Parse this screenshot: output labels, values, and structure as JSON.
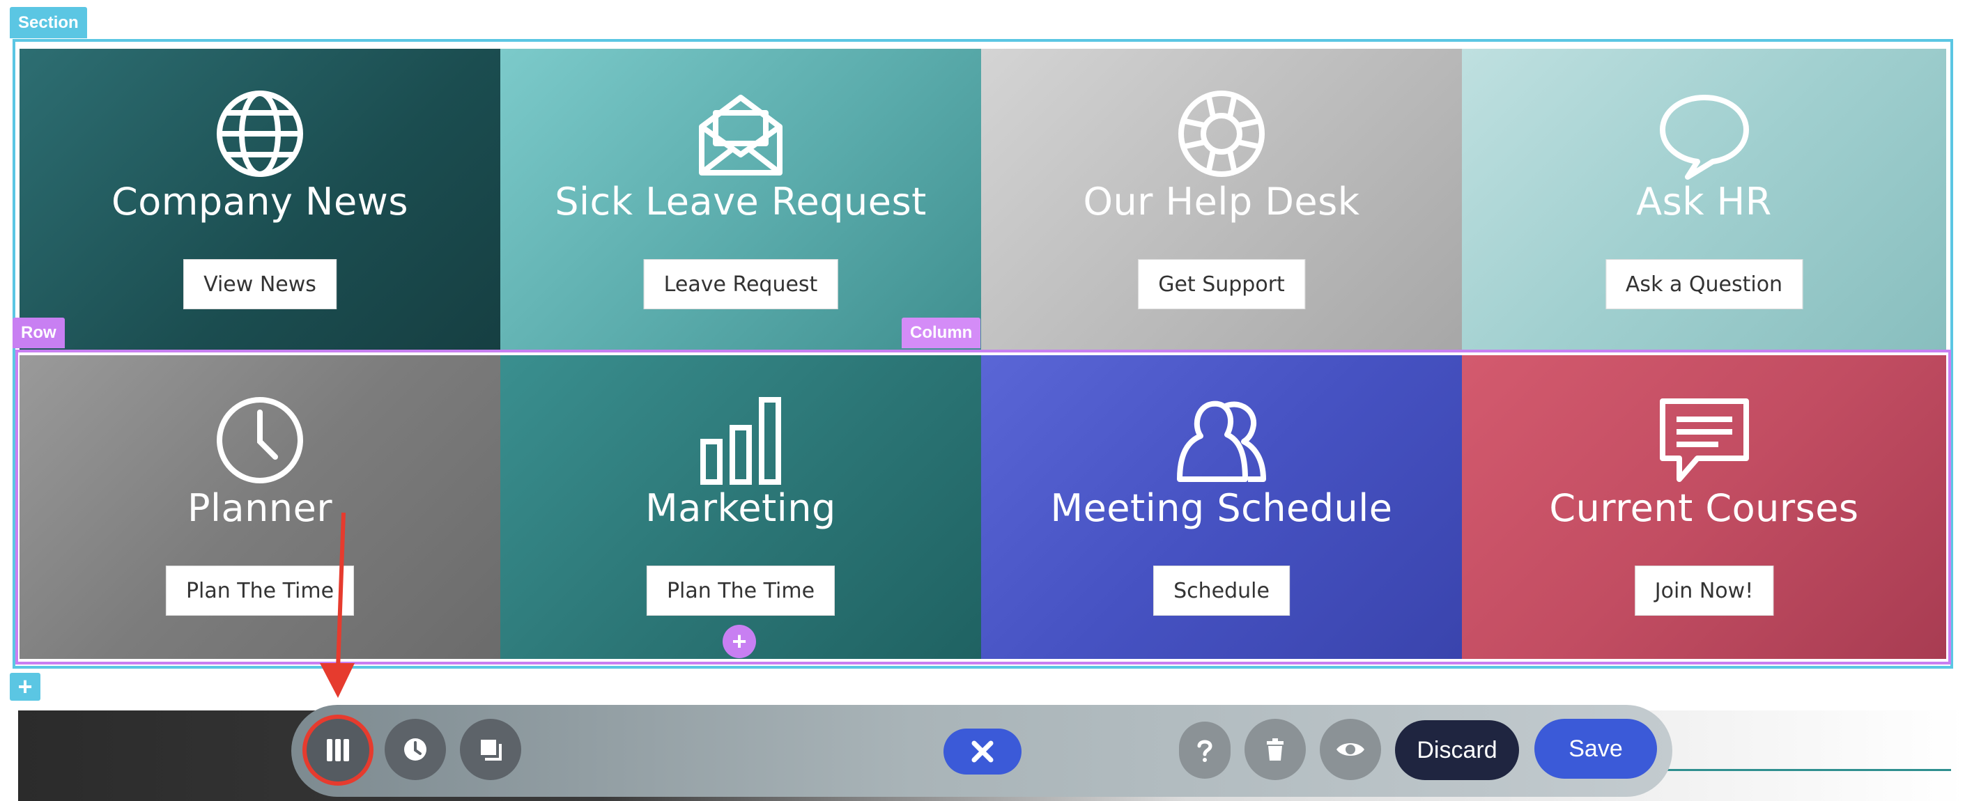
{
  "labels": {
    "section": "Section",
    "row": "Row",
    "column": "Column"
  },
  "tiles_row1": [
    {
      "title": "Company News",
      "button": "View News",
      "icon": "globe-icon",
      "color": "#1f5a5c"
    },
    {
      "title": "Sick Leave Request",
      "button": "Leave Request",
      "icon": "envelope-icon",
      "color": "#5fb8b8"
    },
    {
      "title": "Our Help Desk",
      "button": "Get Support",
      "icon": "lifebuoy-icon",
      "color": "#c9c9c9"
    },
    {
      "title": "Ask HR",
      "button": "Ask a Question",
      "icon": "chat-bubble-icon",
      "color": "#9ed0d0"
    }
  ],
  "tiles_row2": [
    {
      "title": "Planner",
      "button": "Plan The Time",
      "icon": "clock-icon",
      "color": "#8a8a8a"
    },
    {
      "title": "Marketing",
      "button": "Plan The Time",
      "icon": "bar-chart-icon",
      "color": "#2f8080"
    },
    {
      "title": "Meeting Schedule",
      "button": "Schedule",
      "icon": "users-icon",
      "color": "#4a57c8"
    },
    {
      "title": "Current Courses",
      "button": "Join Now!",
      "icon": "message-icon",
      "color": "#c24d62"
    }
  ],
  "add_buttons": {
    "section_add": "+",
    "module_add": "+"
  },
  "toolbar": {
    "discard": "Discard",
    "save": "Save"
  },
  "colors": {
    "section_outline": "#5bc6e3",
    "row_outline": "#c87ff2",
    "primary": "#3b5ad8",
    "discard": "#1f2540",
    "annotation": "#e63b2e"
  }
}
